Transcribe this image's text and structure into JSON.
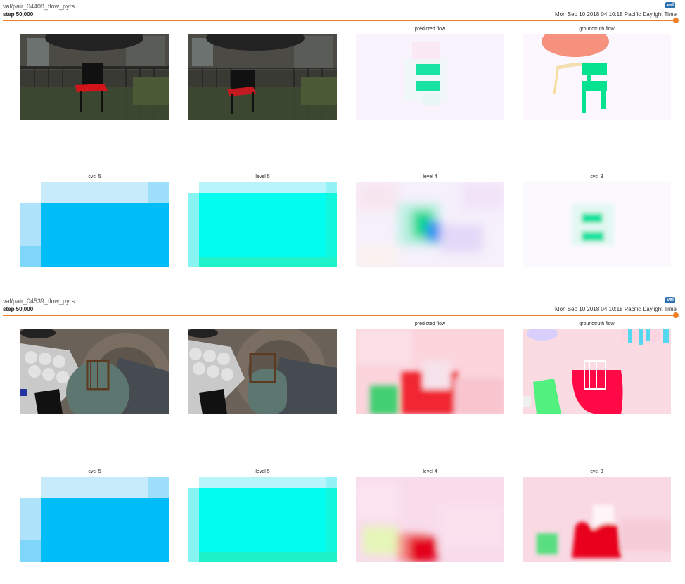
{
  "cards": [
    {
      "title": "val/pair_04408_flow_pyrs",
      "step": "step 50,000",
      "timestamp": "Mon Sep 10 2018 04:10:18 Pacific Daylight Time",
      "run_badge": "val",
      "captions_row1": [
        "",
        "",
        "predicted flow",
        "groundtruth flow"
      ],
      "captions_row2": [
        "cvc_5",
        "level 5",
        "level 4",
        "cvc_3"
      ]
    },
    {
      "title": "val/pair_04539_flow_pyrs",
      "step": "step 50,000",
      "timestamp": "Mon Sep 10 2018 04:10:18 Pacific Daylight Time",
      "run_badge": "val",
      "captions_row1": [
        "",
        "",
        "predicted flow",
        "groundtruth flow"
      ],
      "captions_row2": [
        "cvc_5",
        "level 5",
        "level 4",
        "cvc_3"
      ]
    }
  ],
  "colors": {
    "accent": "#f07f29",
    "badge": "#2c6fb0"
  }
}
